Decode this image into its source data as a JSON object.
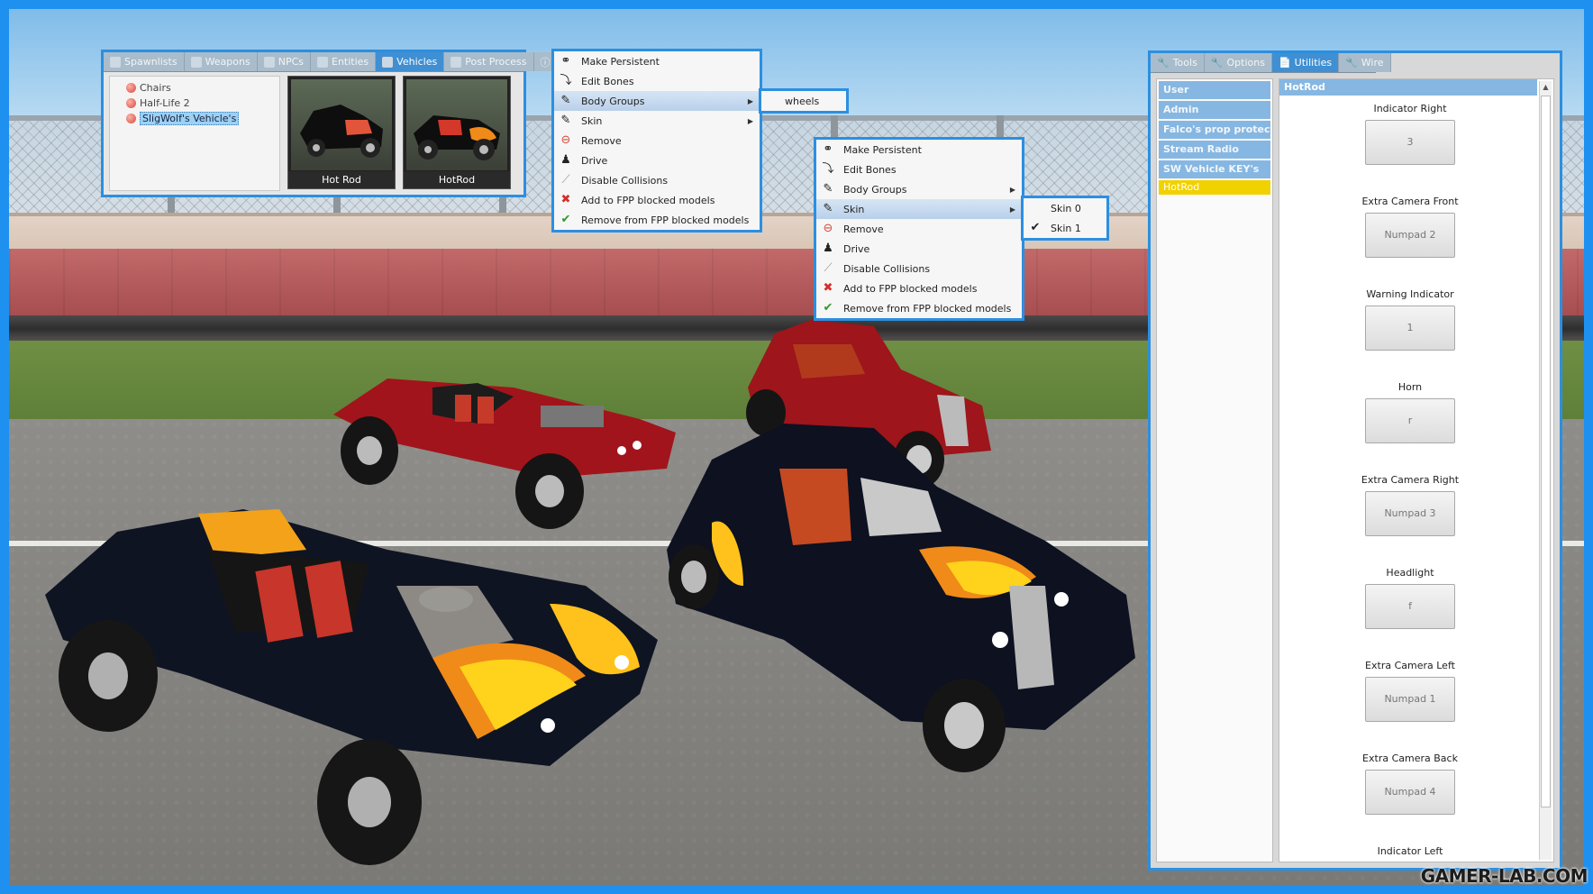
{
  "spawnmenu": {
    "tabs": [
      "Spawnlists",
      "Weapons",
      "NPCs",
      "Entities",
      "Vehicles",
      "Post Process"
    ],
    "active_tab": "Vehicles",
    "tree": [
      "Chairs",
      "Half-Life 2",
      "SligWolf's Vehicle's"
    ],
    "selected_tree_item": "SligWolf's Vehicle's",
    "items": [
      "Hot Rod",
      "HotRod"
    ]
  },
  "context_menu_1": {
    "items": [
      "Make Persistent",
      "Edit Bones",
      "Body Groups",
      "Skin",
      "Remove",
      "Drive",
      "Disable Collisions",
      "Add to FPP blocked models",
      "Remove from FPP blocked models"
    ],
    "highlighted": "Body Groups",
    "submenu": [
      "wheels"
    ]
  },
  "context_menu_2": {
    "items": [
      "Make Persistent",
      "Edit Bones",
      "Body Groups",
      "Skin",
      "Remove",
      "Drive",
      "Disable Collisions",
      "Add to FPP blocked models",
      "Remove from FPP blocked models"
    ],
    "highlighted": "Skin",
    "submenu": [
      "Skin 0",
      "Skin 1"
    ],
    "checked": "Skin 1"
  },
  "utilities": {
    "tabs": [
      "Tools",
      "Options",
      "Utilities",
      "Wire"
    ],
    "active_tab": "Utilities",
    "categories": [
      "User",
      "Admin",
      "Falco's prop protect...",
      "Stream Radio",
      "SW Vehicle KEY's",
      "HotRod"
    ],
    "active_category": "HotRod",
    "panel_title": "HotRod",
    "keybinds": [
      {
        "label": "Indicator Right",
        "key": "3"
      },
      {
        "label": "Extra Camera Front",
        "key": "Numpad 2"
      },
      {
        "label": "Warning Indicator",
        "key": "1"
      },
      {
        "label": "Horn",
        "key": "r"
      },
      {
        "label": "Extra Camera Right",
        "key": "Numpad 3"
      },
      {
        "label": "Headlight",
        "key": "f"
      },
      {
        "label": "Extra Camera Left",
        "key": "Numpad 1"
      },
      {
        "label": "Extra Camera Back",
        "key": "Numpad 4"
      },
      {
        "label": "Indicator Left",
        "key": ""
      }
    ]
  },
  "watermark": "GAMER-LAB.COM",
  "colors": {
    "frame": "#1e90f0",
    "accent": "#2c8fe0",
    "category": "#86b7e2",
    "active_category": "#f2d100"
  }
}
